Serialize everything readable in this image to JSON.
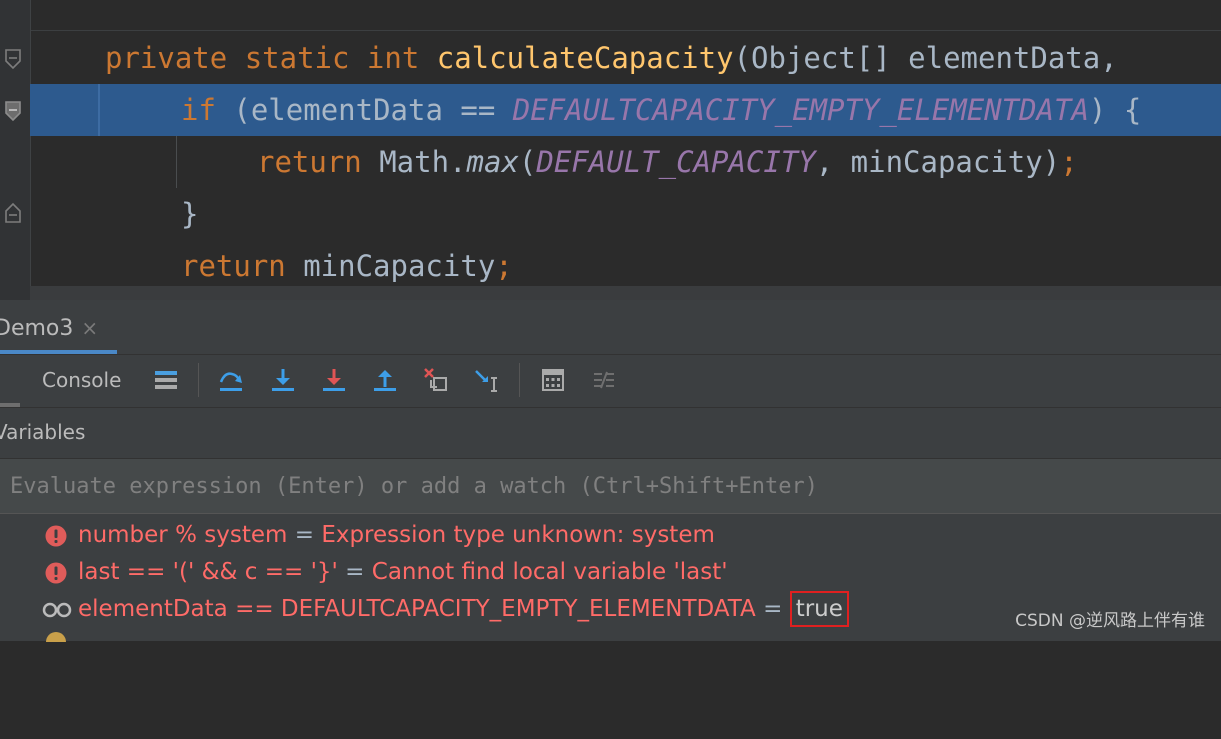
{
  "editor": {
    "lines": [
      {
        "tokens": [
          {
            "t": "private ",
            "c": "kw"
          },
          {
            "t": "static ",
            "c": "kw"
          },
          {
            "t": "int ",
            "c": "kw"
          },
          {
            "t": "calculateCapacity",
            "c": "fn"
          },
          {
            "t": "(Object[] elementData, ",
            "c": "plain"
          }
        ]
      },
      {
        "tokens": [
          {
            "t": "if ",
            "c": "kw"
          },
          {
            "t": "(elementData == ",
            "c": "plain"
          },
          {
            "t": "DEFAULTCAPACITY_EMPTY_ELEMENTDATA",
            "c": "const"
          },
          {
            "t": ") {",
            "c": "plain"
          }
        ]
      },
      {
        "tokens": [
          {
            "t": "return ",
            "c": "kw"
          },
          {
            "t": "Math.",
            "c": "plain"
          },
          {
            "t": "max",
            "c": "plain italic"
          },
          {
            "t": "(",
            "c": "plain"
          },
          {
            "t": "DEFAULT_CAPACITY",
            "c": "const"
          },
          {
            "t": ", minCapacity)",
            "c": "plain"
          },
          {
            "t": ";",
            "c": "kw"
          }
        ]
      },
      {
        "tokens": [
          {
            "t": "}",
            "c": "plain"
          }
        ]
      },
      {
        "tokens": [
          {
            "t": "return ",
            "c": "kw"
          },
          {
            "t": "minCapacity",
            "c": "plain"
          },
          {
            "t": ";",
            "c": "kw"
          }
        ]
      }
    ]
  },
  "debug": {
    "session_tab": "Demo3",
    "close_glyph": "×",
    "console_label": "Console",
    "variables_label": "Variables",
    "eval_placeholder": "Evaluate expression (Enter) or add a watch (Ctrl+Shift+Enter)",
    "watches": [
      {
        "icon": "error-icon",
        "name": "number % system",
        "eq": " = ",
        "value": "Expression type unknown: system",
        "kind": "error"
      },
      {
        "icon": "error-icon",
        "name": "last == '(' && c == '}'",
        "eq": " = ",
        "value": "Cannot find local variable 'last'",
        "kind": "error"
      },
      {
        "icon": "watch-glasses-icon",
        "name": "elementData == DEFAULTCAPACITY_EMPTY_ELEMENTDATA",
        "eq": " = ",
        "value": "true",
        "kind": "value"
      }
    ]
  },
  "watermark": "CSDN @逆风路上伴有谁",
  "colors": {
    "keyword": "#cc7832",
    "function": "#ffc66d",
    "constant": "#9876aa",
    "text": "#a9b7c6",
    "highlight": "#2d5a8e",
    "error": "#ff6b68",
    "accent": "#4a88c7"
  }
}
